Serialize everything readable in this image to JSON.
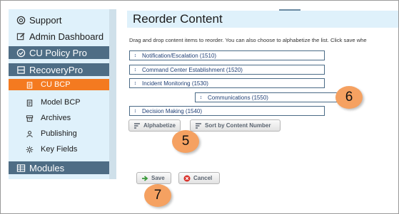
{
  "sidebar": {
    "items": [
      {
        "label": "Support",
        "icon": "support-icon"
      },
      {
        "label": "Admin Dashboard",
        "icon": "edit-icon"
      },
      {
        "label": "CU Policy Pro",
        "icon": "check-circle-icon"
      },
      {
        "label": "RecoveryPro",
        "icon": "layers-icon"
      },
      {
        "label": "CU BCP",
        "icon": "clipboard-icon"
      },
      {
        "label": "Model BCP",
        "icon": "clipboard-icon"
      },
      {
        "label": "Archives",
        "icon": "archive-icon"
      },
      {
        "label": "Publishing",
        "icon": "users-icon"
      },
      {
        "label": "Key Fields",
        "icon": "gear-icon"
      },
      {
        "label": "Modules",
        "icon": "table-icon"
      }
    ]
  },
  "page": {
    "title": "Reorder Content",
    "instructions": "Drag and drop content items to reorder. You can also choose to alphabetize the list. Click save whe"
  },
  "content_items": [
    {
      "label": "Notification/Escalation (1510)"
    },
    {
      "label": "Command Center Establishment (1520)"
    },
    {
      "label": "Incident Monitoring (1530)"
    },
    {
      "label": "Communications (1550)"
    },
    {
      "label": "Decision Making (1540)"
    }
  ],
  "buttons": {
    "alphabetize": "Alphabetize",
    "sort_by_number": "Sort by Content Number",
    "save": "Save",
    "cancel": "Cancel"
  },
  "callouts": {
    "a": "6",
    "b": "5",
    "c": "7"
  },
  "colors": {
    "sidebar_bg": "#dff1fb",
    "header_bg": "#4e6d85",
    "active_bg": "#f47a20",
    "callout": "#f5a161",
    "item_border": "#4a6a86"
  }
}
